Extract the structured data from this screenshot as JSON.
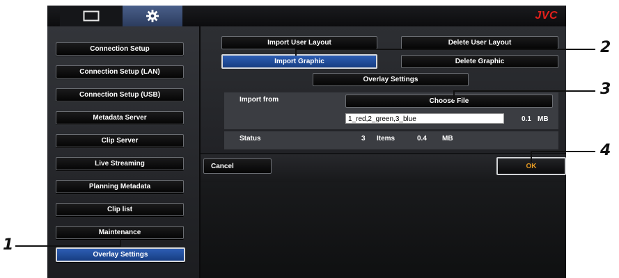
{
  "header": {
    "tabs": [
      {
        "name": "monitor",
        "icon": "monitor-icon"
      },
      {
        "name": "settings",
        "icon": "gear-icon"
      }
    ],
    "brand": "JVC",
    "brand_color": "#e3201b"
  },
  "sidebar": {
    "items": [
      {
        "label": "Connection Setup"
      },
      {
        "label": "Connection Setup (LAN)"
      },
      {
        "label": "Connection Setup (USB)"
      },
      {
        "label": "Metadata Server"
      },
      {
        "label": "Clip Server"
      },
      {
        "label": "Live Streaming"
      },
      {
        "label": "Planning Metadata"
      },
      {
        "label": "Clip list"
      },
      {
        "label": "Maintenance"
      },
      {
        "label": "Overlay Settings",
        "active": true
      }
    ]
  },
  "main": {
    "import_user_layout": "Import User Layout",
    "delete_user_layout": "Delete User Layout",
    "import_graphic": "Import Graphic",
    "delete_graphic": "Delete Graphic",
    "overlay_settings": "Overlay Settings",
    "import_from_label": "Import from",
    "choose_file": "Choose File",
    "file_value": "1_red,2_green,3_blue",
    "file_size": "0.1",
    "file_size_unit": "MB",
    "status_label": "Status",
    "status_count": "3",
    "status_items_label": "Items",
    "status_size": "0.4",
    "status_size_unit": "MB",
    "cancel": "Cancel",
    "ok": "OK"
  },
  "callouts": [
    "1",
    "2",
    "3",
    "4"
  ],
  "colors": {
    "accent_blue": "#2d5eb4",
    "ok_text": "#e59a22"
  }
}
